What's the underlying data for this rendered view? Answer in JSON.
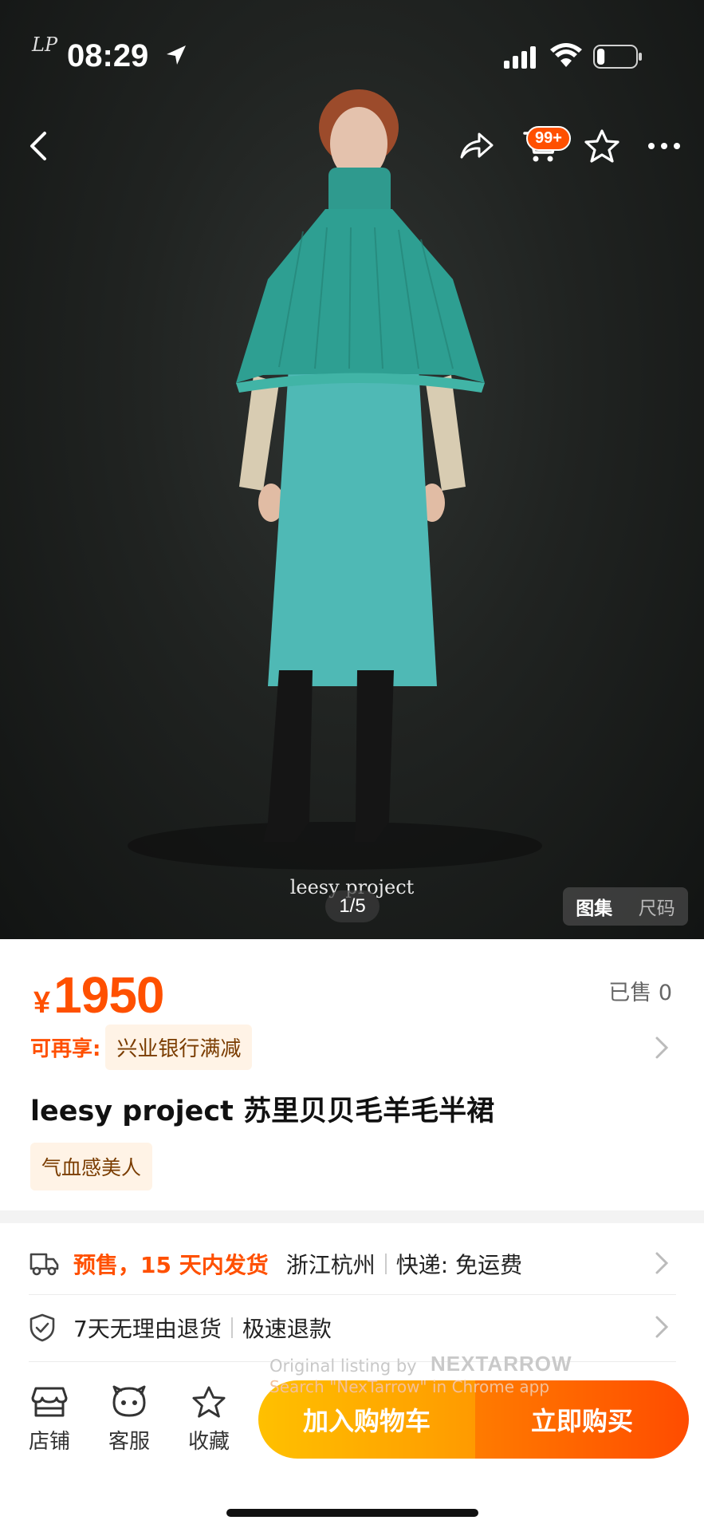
{
  "status_bar": {
    "logo_text": "LP",
    "time": "08:29",
    "battery_level": 0.2
  },
  "top_bar": {
    "icons": [
      "back-icon",
      "share-icon",
      "cart-icon",
      "star-icon",
      "more-icon"
    ],
    "cart_badge": "99+"
  },
  "gallery": {
    "brand_text": "leesy project",
    "pager": "1/5",
    "tabs": [
      "图集",
      "尺码"
    ],
    "active_tab": 0
  },
  "product": {
    "currency": "¥",
    "price": "1950",
    "sold": "已售 0",
    "promo_label": "可再享:",
    "promo_tag": "兴业银行满减",
    "title": "leesy project 苏里贝贝毛羊毛半裙",
    "tag": "气血感美人"
  },
  "shipping": {
    "presale": "预售，15 天内发货",
    "origin": "浙江杭州",
    "delivery": "快递: 免运费"
  },
  "returns": {
    "policy": "7天无理由退货",
    "refund": "极速退款"
  },
  "watermark": {
    "line1": "Original listing by",
    "brand": "NEXTARROW",
    "line2": "Search \"NexTarrow\" in Chrome app"
  },
  "bottom_bar": {
    "shop": "店铺",
    "service": "客服",
    "favorite": "收藏",
    "add_to_cart": "加入购物车",
    "buy_now": "立即购买"
  },
  "colors": {
    "accent": "#ff5000",
    "cart_button": "#ffb000",
    "buy_button": "#ff5a00",
    "promo_bg": "#fff3e6"
  }
}
